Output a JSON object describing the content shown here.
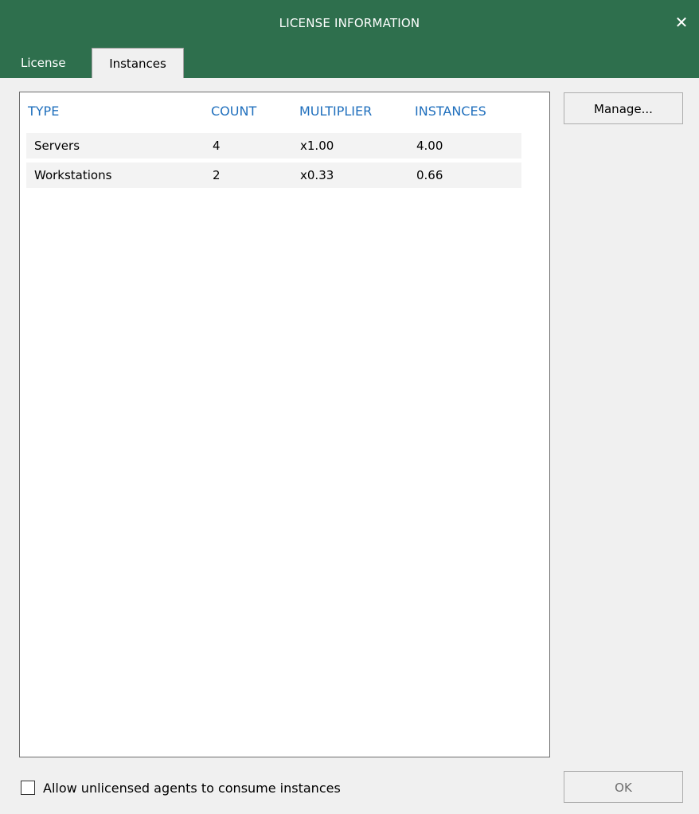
{
  "window": {
    "title": "LICENSE INFORMATION",
    "close_glyph": "✕"
  },
  "tabs": [
    {
      "label": "License",
      "active": false
    },
    {
      "label": "Instances",
      "active": true
    }
  ],
  "table": {
    "columns": [
      "TYPE",
      "COUNT",
      "MULTIPLIER",
      "INSTANCES"
    ],
    "rows": [
      [
        "Servers",
        "4",
        "x1.00",
        "4.00"
      ],
      [
        "Workstations",
        "2",
        "x0.33",
        "0.66"
      ]
    ]
  },
  "buttons": {
    "manage": "Manage...",
    "ok": "OK"
  },
  "checkbox": {
    "label": "Allow unlicensed agents to consume instances",
    "checked": false
  },
  "colors": {
    "titlebar": "#2e6f4d",
    "header_text": "#1f6fbd"
  }
}
